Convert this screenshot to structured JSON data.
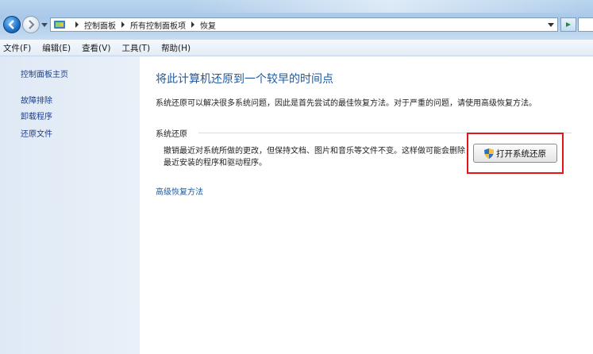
{
  "addressbar": {
    "crumbs": [
      "控制面板",
      "所有控制面板项",
      "恢复"
    ]
  },
  "menubar": {
    "items": [
      "文件(F)",
      "编辑(E)",
      "查看(V)",
      "工具(T)",
      "帮助(H)"
    ]
  },
  "sidebar": {
    "items": [
      {
        "label": "控制面板主页"
      },
      {
        "label": "故障排除"
      },
      {
        "label": "卸载程序"
      },
      {
        "label": "还原文件"
      }
    ]
  },
  "main": {
    "title": "将此计算机还原到一个较早的时间点",
    "description": "系统还原可以解决很多系统问题，因此是首先尝试的最佳恢复方法。对于严重的问题，请使用高级恢复方法。",
    "section_label": "系统还原",
    "section_body": "撤销最近对系统所做的更改，但保持文档、图片和音乐等文件不变。这样做可能会删除最近安装的程序和驱动程序。",
    "open_restore_label": "打开系统还原",
    "advanced_link": "高级恢复方法"
  },
  "icons": {
    "back": "back-arrow-icon",
    "forward": "forward-arrow-icon",
    "control_panel": "control-panel-icon",
    "refresh": "refresh-icon",
    "shield": "uac-shield-icon"
  },
  "colors": {
    "highlight_border": "#e3151a",
    "link": "#1e5aa0"
  }
}
